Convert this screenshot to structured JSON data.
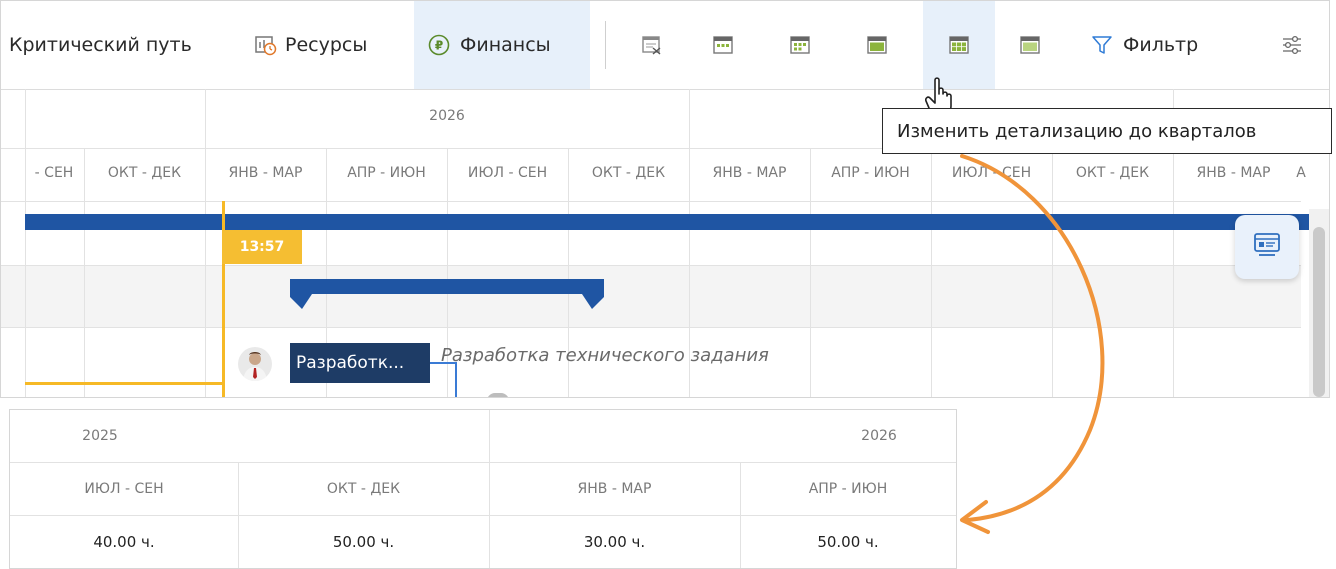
{
  "toolbar": {
    "critical_path": "Критический путь",
    "resources": "Ресурсы",
    "finances": "Финансы",
    "filter": "Фильтр"
  },
  "timeline": {
    "year_top": "2026",
    "quarters": [
      "- СЕН",
      "ОКТ - ДЕК",
      "ЯНВ - МАР",
      "АПР - ИЮН",
      "ИЮЛ - СЕН",
      "ОКТ - ДЕК",
      "ЯНВ - МАР",
      "АПР - ИЮН",
      "ИЮЛ - СЕН",
      "ОКТ - ДЕК",
      "ЯНВ - МАР",
      "А"
    ]
  },
  "today_marker": "13:57",
  "task": {
    "short_label": "Разработк...",
    "full_name": "Разработка технического задания"
  },
  "tooltip": "Изменить детализацию до кварталов",
  "detail": {
    "years": [
      "2025",
      "2026"
    ],
    "quarters": [
      "ИЮЛ - СЕН",
      "ОКТ - ДЕК",
      "ЯНВ - МАР",
      "АПР - ИЮН"
    ],
    "values": [
      "40.00 ч.",
      "50.00 ч.",
      "30.00 ч.",
      "50.00 ч."
    ]
  },
  "colors": {
    "accent_blue": "#1f55a3",
    "today_yellow": "#f5be32",
    "arrow_orange": "#f0943a",
    "active_tab_bg": "#e7f0fa",
    "task_label_bg": "#1e3c66"
  }
}
